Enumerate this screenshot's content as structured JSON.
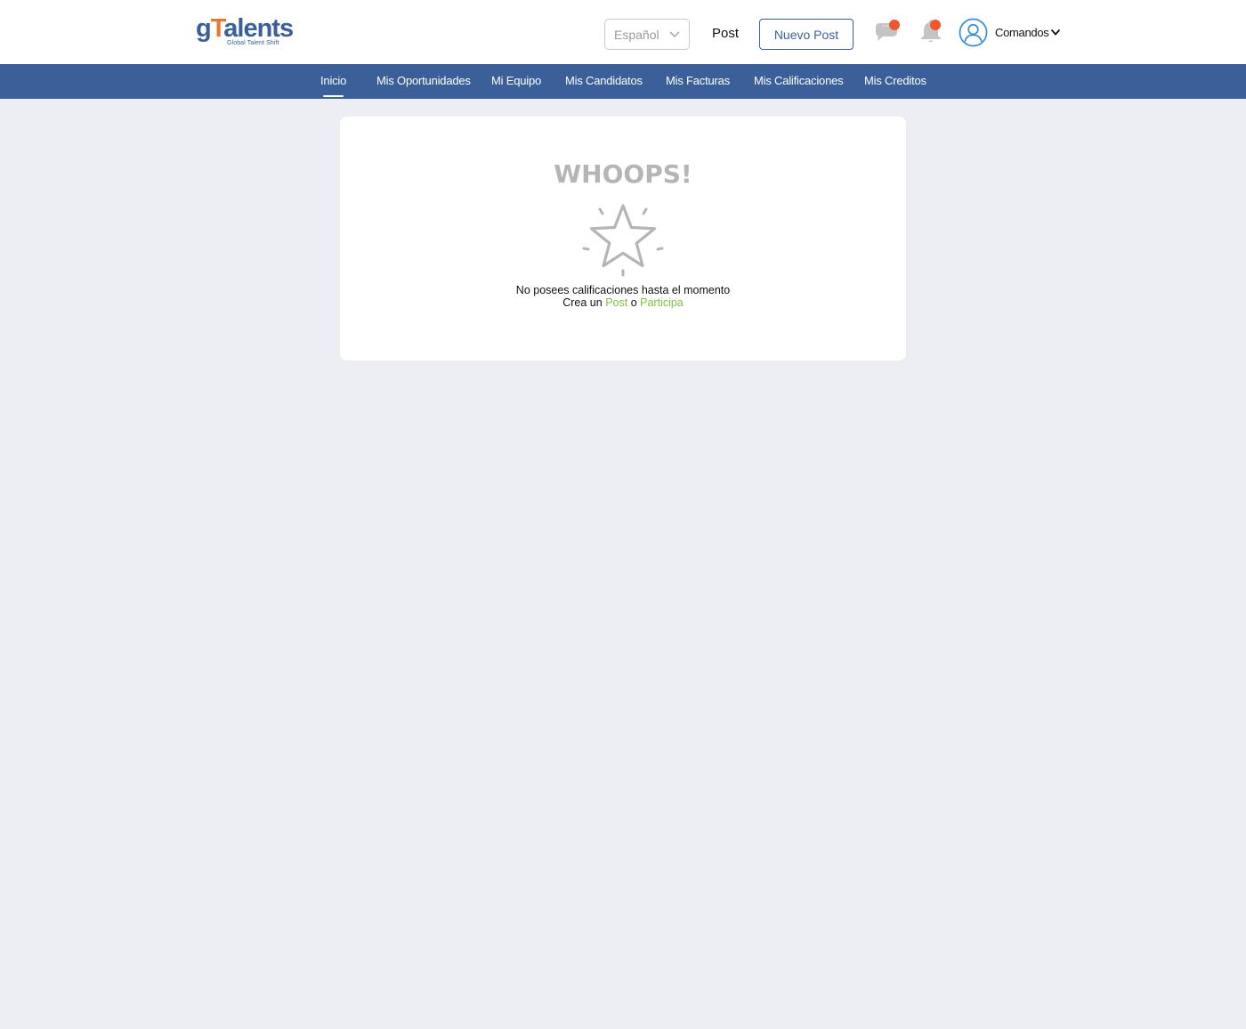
{
  "brand": {
    "logo_main_a": "g",
    "logo_main_tie": "T",
    "logo_main_b": "alents",
    "logo_sub": "Global Talent Shift"
  },
  "header": {
    "language": {
      "selected": "Español"
    },
    "post_link": "Post",
    "new_post_button": "Nuevo Post",
    "user_name": "Comandos"
  },
  "nav": {
    "items": [
      {
        "label": "Inicio",
        "active": true
      },
      {
        "label": "Mis Oportunidades"
      },
      {
        "label": "Mi Equipo"
      },
      {
        "label": "Mis Candidatos"
      },
      {
        "label": "Mis Facturas"
      },
      {
        "label": "Mis Calificaciones"
      },
      {
        "label": "Mis Creditos"
      }
    ]
  },
  "empty_state": {
    "title": "WHOOPS!",
    "icon": "star-icon",
    "message": "No posees calificaciones hasta el momento",
    "cta_prefix": "Crea un",
    "cta_post": "Post",
    "cta_middle": "o",
    "cta_participate": "Participa"
  },
  "colors": {
    "primary": "#3b5f99",
    "background": "#eceef3",
    "notification_dot": "#f0562b",
    "link_green": "#7cc043",
    "muted_gray": "#b5b5b5"
  }
}
